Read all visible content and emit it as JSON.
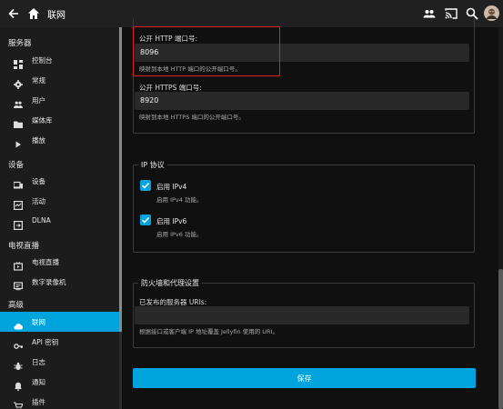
{
  "header": {
    "title": "联网",
    "icons": [
      "back-arrow-icon",
      "home-icon",
      "users-icon",
      "cast-icon",
      "search-icon",
      "user-avatar"
    ]
  },
  "sidebar": {
    "sections": [
      {
        "title": "服务器",
        "items": [
          {
            "label": "控制台",
            "icon": "dashboard-icon"
          },
          {
            "label": "常规",
            "icon": "gear-icon"
          },
          {
            "label": "用户",
            "icon": "people-icon"
          },
          {
            "label": "媒体库",
            "icon": "folder-icon"
          },
          {
            "label": "播放",
            "icon": "play-icon"
          }
        ]
      },
      {
        "title": "设备",
        "items": [
          {
            "label": "设备",
            "icon": "devices-icon"
          },
          {
            "label": "活动",
            "icon": "activity-icon"
          },
          {
            "label": "DLNA",
            "icon": "dlna-icon"
          }
        ]
      },
      {
        "title": "电视直播",
        "items": [
          {
            "label": "电视直播",
            "icon": "live-tv-icon"
          },
          {
            "label": "数字录像机",
            "icon": "dvr-icon"
          }
        ]
      },
      {
        "title": "高级",
        "items": [
          {
            "label": "联网",
            "icon": "cloud-icon",
            "active": true
          },
          {
            "label": "API 密钥",
            "icon": "key-icon"
          },
          {
            "label": "日志",
            "icon": "bug-icon"
          },
          {
            "label": "通知",
            "icon": "bell-icon"
          },
          {
            "label": "插件",
            "icon": "cart-icon"
          }
        ]
      }
    ]
  },
  "ports": {
    "http_label": "公开 HTTP 端口号:",
    "http_value": "8096",
    "http_help": "映射到本地 HTTP 端口的公开端口号。",
    "https_label": "公开 HTTPS 端口号:",
    "https_value": "8920",
    "https_help": "映射到本地 HTTPS 端口的公开端口号。"
  },
  "ip_protocol": {
    "legend": "IP 协议",
    "ipv4_label": "启用 IPv4",
    "ipv4_help": "启用 IPv4 功能。",
    "ipv4_checked": true,
    "ipv6_label": "启用 IPv6",
    "ipv6_help": "启用 IPv6 功能。",
    "ipv6_checked": true
  },
  "firewall": {
    "legend": "防火墙和代理设置",
    "uris_label": "已发布的服务器 URIs:",
    "uris_value": "",
    "uris_help": "根据接口或客户端 IP 地址覆盖 Jellyfin 使用的 URI。"
  },
  "save_label": "保存",
  "colors": {
    "accent": "#00a4dc",
    "highlight": "#e02020",
    "background": "#101010"
  }
}
